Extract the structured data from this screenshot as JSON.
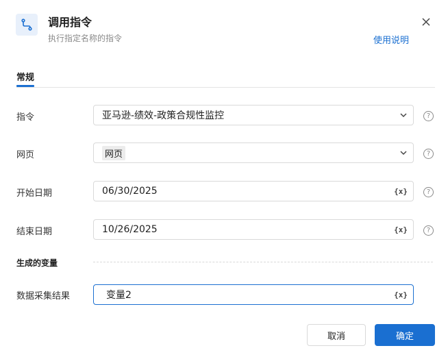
{
  "dialog": {
    "title": "调用指令",
    "subtitle": "执行指定名称的指令",
    "help_link": "使用说明",
    "header_icon": "route-icon",
    "close_icon": "close-icon"
  },
  "tabs": [
    {
      "label": "常规",
      "active": true
    }
  ],
  "fields": [
    {
      "label": "指令",
      "value": "亚马逊-绩效-政策合规性监控",
      "control": "select",
      "help": true
    },
    {
      "label": "网页",
      "value": "网页",
      "control": "select-tag",
      "help": true
    },
    {
      "label": "开始日期",
      "value": "06/30/2025",
      "control": "input-variable",
      "help": true
    },
    {
      "label": "结束日期",
      "value": "10/26/2025",
      "control": "input-variable",
      "help": true
    }
  ],
  "output_section": {
    "title": "生成的变量",
    "fields": [
      {
        "label": "数据采集结果",
        "value": "变量2",
        "control": "input-variable",
        "focused": true
      }
    ]
  },
  "icons": {
    "variable_glyph": "{x}",
    "help_glyph": "?"
  },
  "buttons": {
    "cancel": "取消",
    "ok": "确定"
  },
  "colors": {
    "accent": "#1a6fd1",
    "header_icon_bg": "#e8f0fb"
  }
}
